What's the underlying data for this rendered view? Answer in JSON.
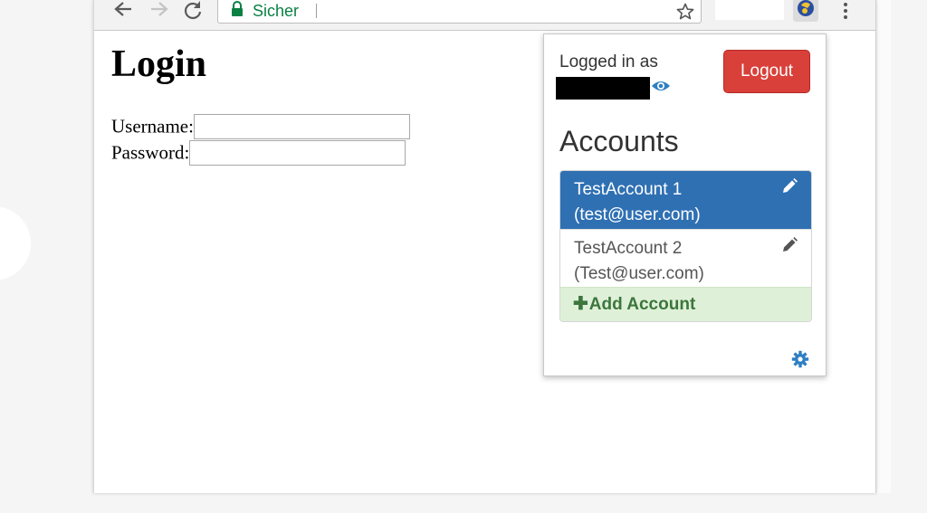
{
  "browser": {
    "omnibox": {
      "secure_label": "Sicher"
    }
  },
  "page": {
    "title": "Login",
    "username_label": "Username:",
    "password_label": "Password:",
    "username_value": "",
    "password_value": ""
  },
  "popup": {
    "logged_in_label": "Logged in as",
    "logout_label": "Logout",
    "accounts_heading": "Accounts",
    "accounts": [
      {
        "name": "TestAccount 1",
        "email": "(test@user.com)",
        "active": true
      },
      {
        "name": "TestAccount 2",
        "email": "(Test@user.com)",
        "active": false
      }
    ],
    "add_account_label": "Add Account"
  },
  "colors": {
    "secure_green": "#0b8043",
    "active_blue": "#2f70b3",
    "logout_red": "#d9403a",
    "add_green_bg": "#dff0d8",
    "add_green_text": "#3c763d",
    "icon_blue": "#2f7fc1"
  },
  "icons": [
    "back-arrow-icon",
    "forward-arrow-icon",
    "reload-icon",
    "lock-icon",
    "star-icon",
    "extension-icon",
    "menu-dots-icon",
    "eye-icon",
    "pencil-icon",
    "plus-icon",
    "gear-icon"
  ]
}
